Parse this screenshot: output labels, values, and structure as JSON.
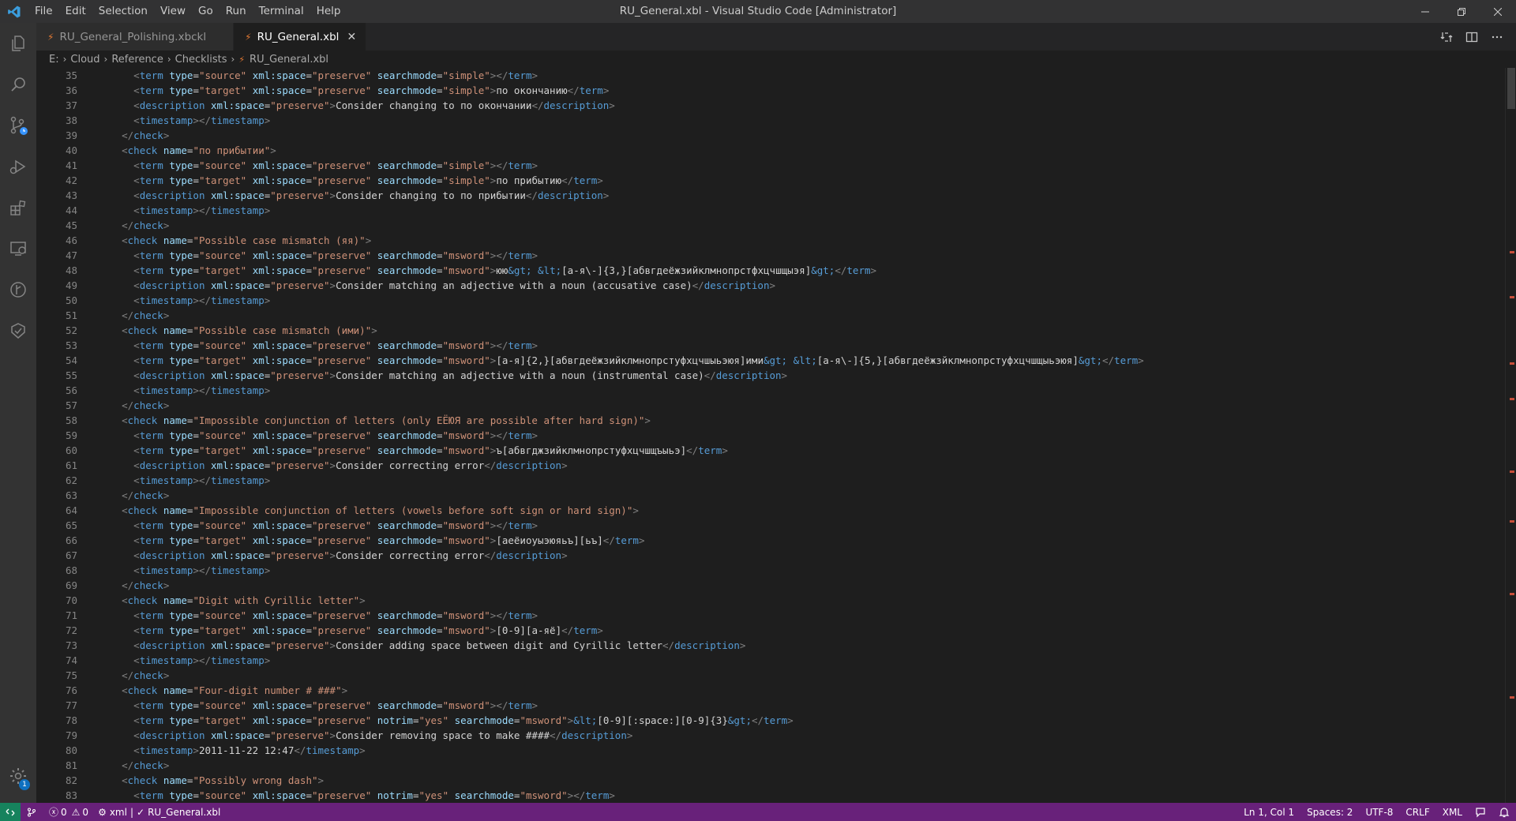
{
  "window": {
    "title": "RU_General.xbl - Visual Studio Code [Administrator]",
    "menu": [
      "File",
      "Edit",
      "Selection",
      "View",
      "Go",
      "Run",
      "Terminal",
      "Help"
    ]
  },
  "tabs": [
    {
      "label": "RU_General_Polishing.xbckl",
      "active": false
    },
    {
      "label": "RU_General.xbl",
      "active": true
    }
  ],
  "breadcrumb": {
    "items": [
      "E:",
      "Cloud",
      "Reference",
      "Checklists"
    ],
    "file": "RU_General.xbl"
  },
  "activity_badge": "1",
  "colors": {
    "statusbar": "#68217a",
    "remote": "#16825d",
    "tag": "#569cd6",
    "attr": "#9cdcfe",
    "string": "#ce9178"
  },
  "status": {
    "problems_errors": "0",
    "problems_warnings": "0",
    "language_mode": "xml",
    "file_status": "RU_General.xbl",
    "cursor": "Ln 1, Col 1",
    "spaces": "Spaces: 2",
    "encoding": "UTF-8",
    "eol": "CRLF",
    "language": "XML"
  },
  "code_lines": [
    {
      "num": "35",
      "text": "      <term type=\"source\" xml:space=\"preserve\" searchmode=\"simple\"></term>"
    },
    {
      "num": "36",
      "text": "      <term type=\"target\" xml:space=\"preserve\" searchmode=\"simple\">по окончанию</term>"
    },
    {
      "num": "37",
      "text": "      <description xml:space=\"preserve\">Consider changing to по окончании</description>"
    },
    {
      "num": "38",
      "text": "      <timestamp></timestamp>"
    },
    {
      "num": "39",
      "text": "    </check>"
    },
    {
      "num": "40",
      "text": "    <check name=\"по прибытии\">"
    },
    {
      "num": "41",
      "text": "      <term type=\"source\" xml:space=\"preserve\" searchmode=\"simple\"></term>"
    },
    {
      "num": "42",
      "text": "      <term type=\"target\" xml:space=\"preserve\" searchmode=\"simple\">по прибытию</term>"
    },
    {
      "num": "43",
      "text": "      <description xml:space=\"preserve\">Consider changing to по прибытии</description>"
    },
    {
      "num": "44",
      "text": "      <timestamp></timestamp>"
    },
    {
      "num": "45",
      "text": "    </check>"
    },
    {
      "num": "46",
      "text": "    <check name=\"Possible case mismatch (яя)\">"
    },
    {
      "num": "47",
      "text": "      <term type=\"source\" xml:space=\"preserve\" searchmode=\"msword\"></term>"
    },
    {
      "num": "48",
      "text": "      <term type=\"target\" xml:space=\"preserve\" searchmode=\"msword\">юю&gt; &lt;[а-я\\-]{3,}[абвгдеёжзийклмнопрстфхцчшщыэя]&gt;</term>"
    },
    {
      "num": "49",
      "text": "      <description xml:space=\"preserve\">Consider matching an adjective with a noun (accusative case)</description>"
    },
    {
      "num": "50",
      "text": "      <timestamp></timestamp>"
    },
    {
      "num": "51",
      "text": "    </check>"
    },
    {
      "num": "52",
      "text": "    <check name=\"Possible case mismatch (ими)\">"
    },
    {
      "num": "53",
      "text": "      <term type=\"source\" xml:space=\"preserve\" searchmode=\"msword\"></term>"
    },
    {
      "num": "54",
      "text": "      <term type=\"target\" xml:space=\"preserve\" searchmode=\"msword\">[а-я]{2,}[абвгдеёжзийклмнопрстуфхцчшыьэюя]ими&gt; &lt;[а-я\\-]{5,}[абвгдеёжзйклмнопрстуфхцчшщыьэюя]&gt;</term>"
    },
    {
      "num": "55",
      "text": "      <description xml:space=\"preserve\">Consider matching an adjective with a noun (instrumental case)</description>"
    },
    {
      "num": "56",
      "text": "      <timestamp></timestamp>"
    },
    {
      "num": "57",
      "text": "    </check>"
    },
    {
      "num": "58",
      "text": "    <check name=\"Impossible conjunction of letters (only ЕЁЮЯ are possible after hard sign)\">"
    },
    {
      "num": "59",
      "text": "      <term type=\"source\" xml:space=\"preserve\" searchmode=\"msword\"></term>"
    },
    {
      "num": "60",
      "text": "      <term type=\"target\" xml:space=\"preserve\" searchmode=\"msword\">ъ[абвгджзийклмнопрстуфхцчшщъыьэ]</term>"
    },
    {
      "num": "61",
      "text": "      <description xml:space=\"preserve\">Consider correcting error</description>"
    },
    {
      "num": "62",
      "text": "      <timestamp></timestamp>"
    },
    {
      "num": "63",
      "text": "    </check>"
    },
    {
      "num": "64",
      "text": "    <check name=\"Impossible conjunction of letters (vowels before soft sign or hard sign)\">"
    },
    {
      "num": "65",
      "text": "      <term type=\"source\" xml:space=\"preserve\" searchmode=\"msword\"></term>"
    },
    {
      "num": "66",
      "text": "      <term type=\"target\" xml:space=\"preserve\" searchmode=\"msword\">[аеёиоуыэюяьъ][ьъ]</term>"
    },
    {
      "num": "67",
      "text": "      <description xml:space=\"preserve\">Consider correcting error</description>"
    },
    {
      "num": "68",
      "text": "      <timestamp></timestamp>"
    },
    {
      "num": "69",
      "text": "    </check>"
    },
    {
      "num": "70",
      "text": "    <check name=\"Digit with Cyrillic letter\">"
    },
    {
      "num": "71",
      "text": "      <term type=\"source\" xml:space=\"preserve\" searchmode=\"msword\"></term>"
    },
    {
      "num": "72",
      "text": "      <term type=\"target\" xml:space=\"preserve\" searchmode=\"msword\">[0-9][а-яё]</term>"
    },
    {
      "num": "73",
      "text": "      <description xml:space=\"preserve\">Consider adding space between digit and Cyrillic letter</description>"
    },
    {
      "num": "74",
      "text": "      <timestamp></timestamp>"
    },
    {
      "num": "75",
      "text": "    </check>"
    },
    {
      "num": "76",
      "text": "    <check name=\"Four-digit number # ###\">"
    },
    {
      "num": "77",
      "text": "      <term type=\"source\" xml:space=\"preserve\" searchmode=\"msword\"></term>"
    },
    {
      "num": "78",
      "text": "      <term type=\"target\" xml:space=\"preserve\" notrim=\"yes\" searchmode=\"msword\">&lt;[0-9][:space:][0-9]{3}&gt;</term>"
    },
    {
      "num": "79",
      "text": "      <description xml:space=\"preserve\">Consider removing space to make ####</description>"
    },
    {
      "num": "80",
      "text": "      <timestamp>2011-11-22 12:47</timestamp>"
    },
    {
      "num": "81",
      "text": "    </check>"
    },
    {
      "num": "82",
      "text": "    <check name=\"Possibly wrong dash\">"
    },
    {
      "num": "83",
      "text": "      <term type=\"source\" xml:space=\"preserve\" notrim=\"yes\" searchmode=\"msword\"></term>"
    }
  ]
}
